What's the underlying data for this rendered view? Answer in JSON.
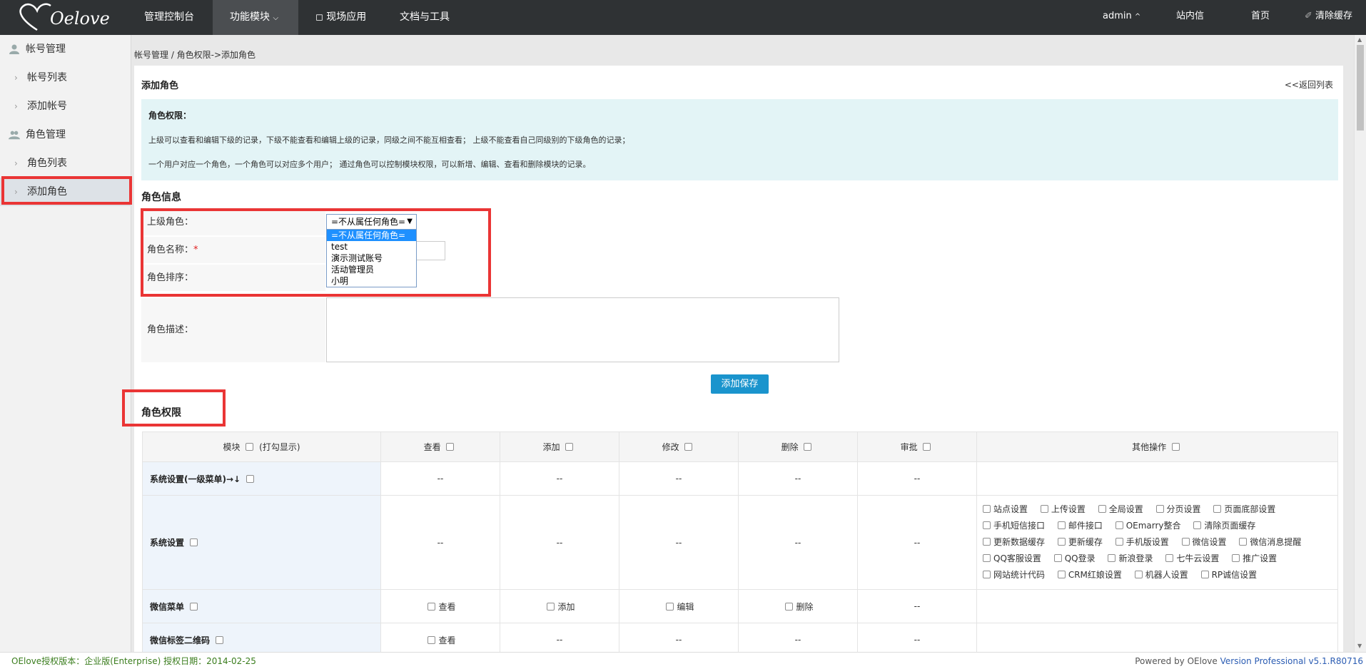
{
  "app": {
    "logo_text": "Oelove"
  },
  "topnav": {
    "items": [
      "管理控制台",
      "功能模块",
      "现场应用",
      "文档与工具"
    ],
    "right": {
      "user": "admin",
      "messages": "站内信",
      "home": "首页",
      "clear_cache": "清除缓存"
    }
  },
  "sidebar": {
    "groups": [
      {
        "label": "帐号管理",
        "items": [
          "帐号列表",
          "添加帐号"
        ]
      },
      {
        "label": "角色管理",
        "items": [
          "角色列表",
          "添加角色"
        ]
      }
    ]
  },
  "breadcrumb": "帐号管理 / 角色权限->添加角色",
  "panel": {
    "title": "添加角色",
    "back_link": "<<返回列表",
    "info": {
      "title": "角色权限：",
      "line1": "上级可以查看和编辑下级的记录，下级不能查看和编辑上级的记录，同级之间不能互相查看； 上级不能查看自己同级别的下级角色的记录；",
      "line2": "一个用户对应一个角色，一个角色可以对应多个用户； 通过角色可以控制模块权限，可以新增、编辑、查看和删除模块的记录。"
    }
  },
  "role_info": {
    "section_title": "角色信息",
    "parent_label": "上级角色：",
    "name_label": "角色名称：",
    "required_mark": "*",
    "order_label": "角色排序：",
    "desc_label": "角色描述：",
    "parent_selected": "=不从属任何角色=",
    "parent_options": [
      "=不从属任何角色=",
      "test",
      "演示测试账号",
      "活动管理员",
      "小明"
    ],
    "save_button": "添加保存"
  },
  "permissions": {
    "section_title": "角色权限",
    "headers": {
      "module": "模块",
      "module_hint": "(打勾显示)",
      "view": "查看",
      "add": "添加",
      "edit": "修改",
      "delete": "删除",
      "approve": "审批",
      "other": "其他操作"
    },
    "placeholder": "--",
    "rows": [
      {
        "name": "系统设置(一级菜单)→↓"
      },
      {
        "name": "系统设置",
        "other_ops": [
          "站点设置",
          "上传设置",
          "全局设置",
          "分页设置",
          "页面底部设置",
          "手机短信接口",
          "邮件接口",
          "OEmarry整合",
          "清除页面缓存",
          "更新数据缓存",
          "更新缓存",
          "手机版设置",
          "微信设置",
          "微信消息提醒",
          "QQ客服设置",
          "QQ登录",
          "新浪登录",
          "七牛云设置",
          "推广设置",
          "网站统计代码",
          "CRM红娘设置",
          "机器人设置",
          "RP诚信设置"
        ]
      },
      {
        "name": "微信菜单",
        "view": "查看",
        "add": "添加",
        "edit": "编辑",
        "delete": "删除"
      },
      {
        "name": "微信标签二维码",
        "view": "查看"
      }
    ]
  },
  "footer": {
    "left": "OElove授权版本：企业版(Enterprise) 授权日期：2014-02-25",
    "right_prefix": "Powered by OElove ",
    "right_version": "Version Professional v5.1.R80716"
  }
}
